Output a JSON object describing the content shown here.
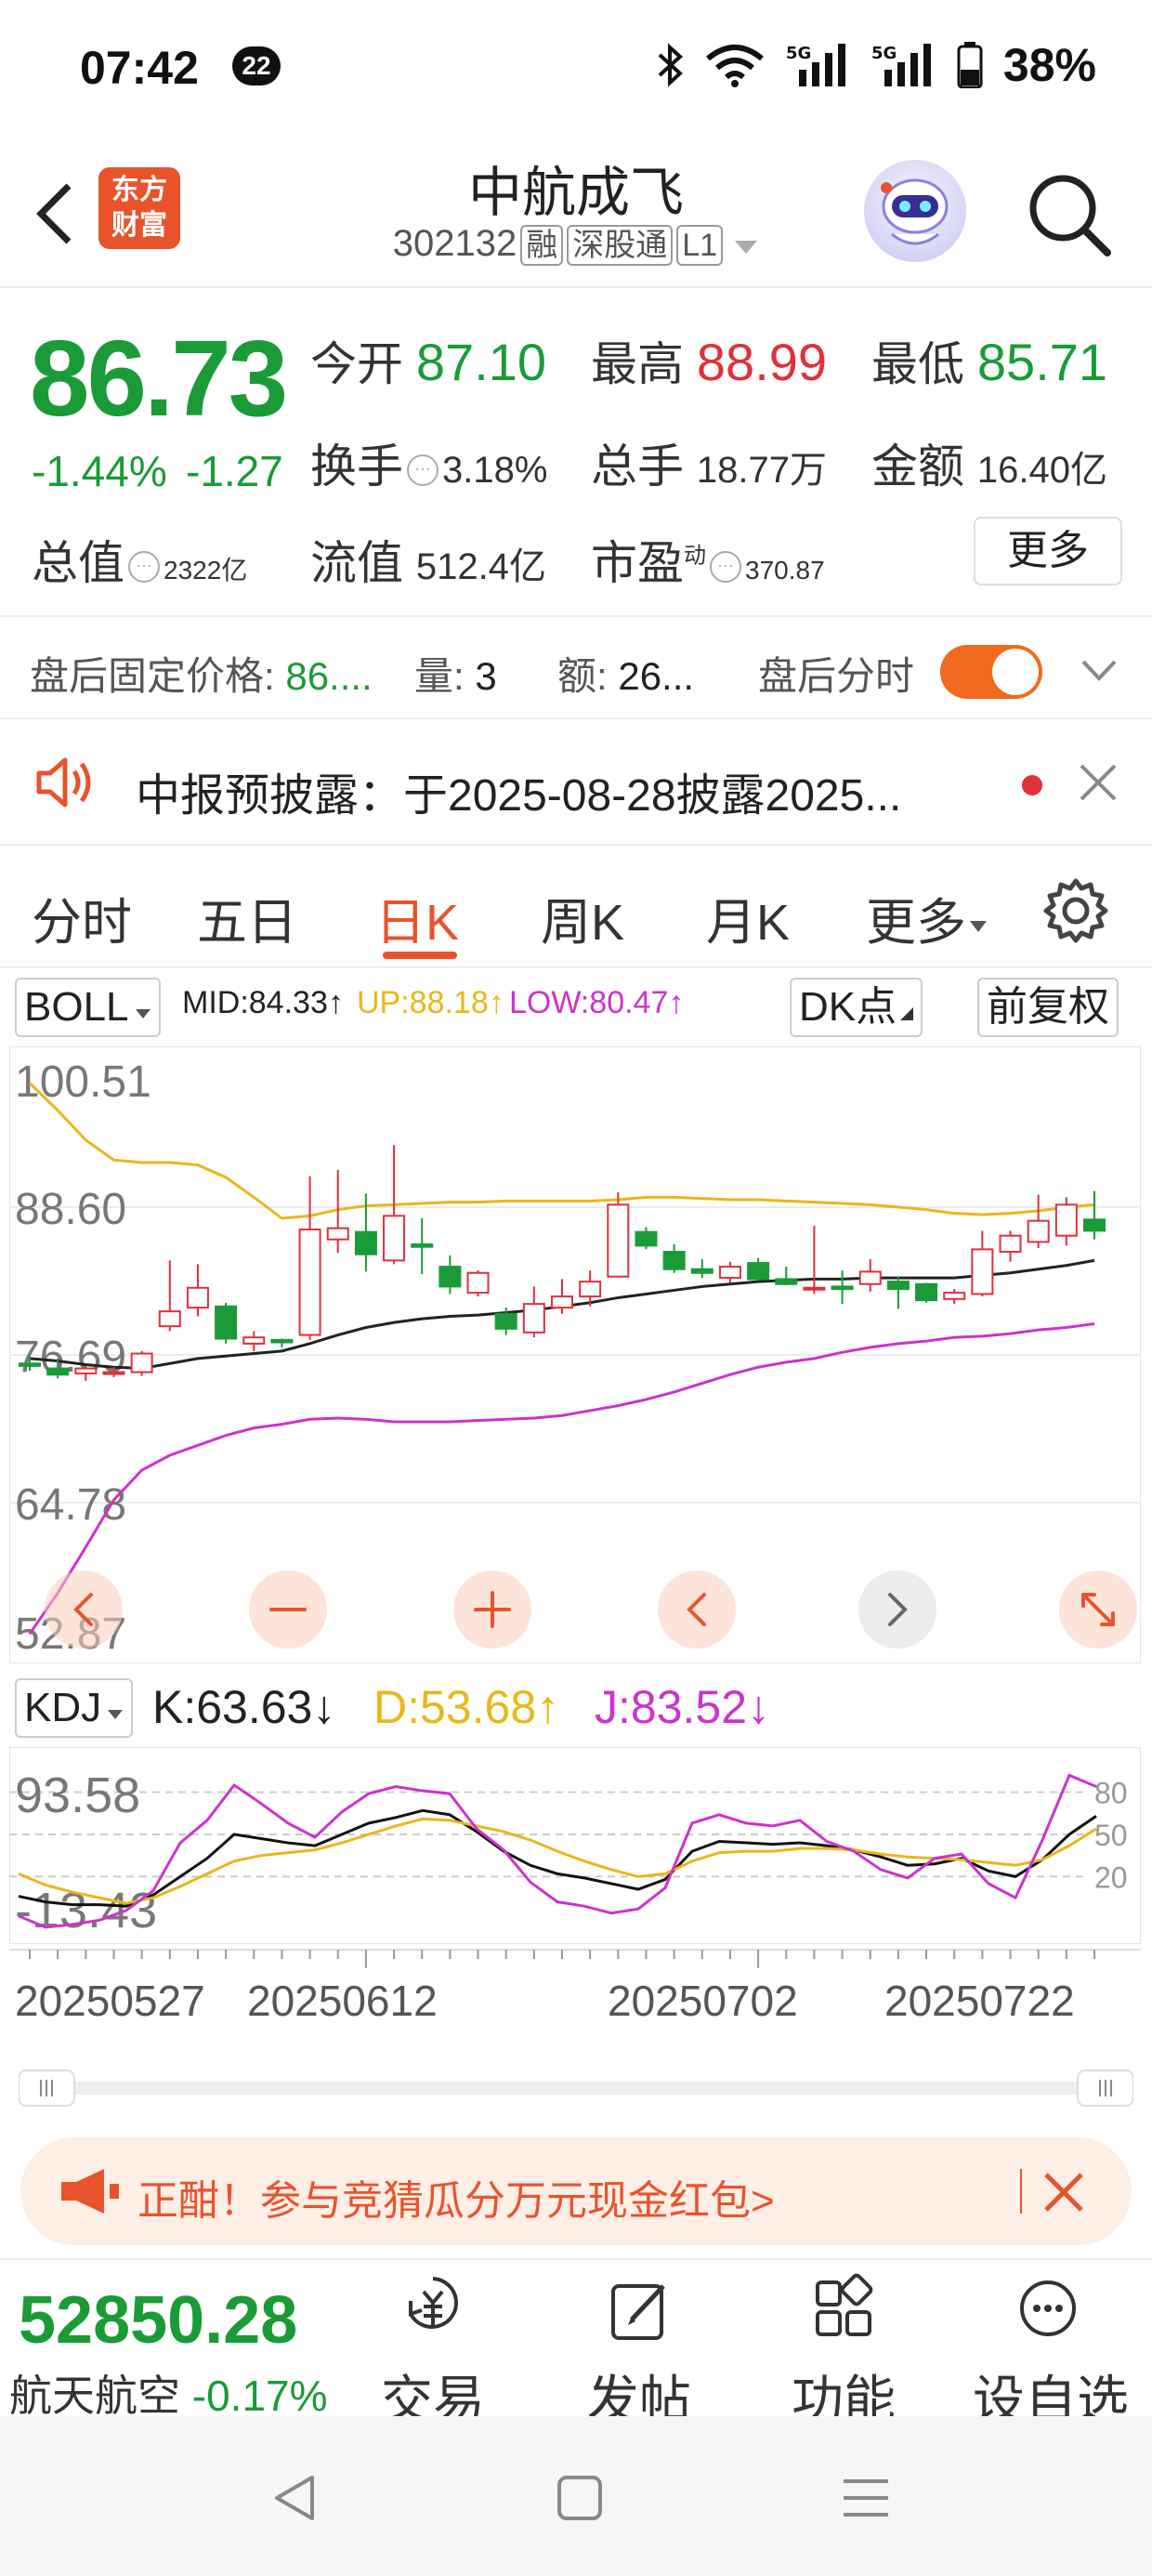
{
  "status_bar": {
    "time": "07:42",
    "notif_count": "22",
    "battery": "38%"
  },
  "header": {
    "logo_text_top": "东方",
    "logo_text_bottom": "财富",
    "stock_name": "中航成飞",
    "stock_code": "302132",
    "tag_margin": "融",
    "tag_connect": "深股通",
    "tag_level": "L1"
  },
  "quote": {
    "price": "86.73",
    "change_pct": "-1.44%",
    "change": "-1.27",
    "open_label": "今开",
    "open": "87.10",
    "high_label": "最高",
    "high": "88.99",
    "low_label": "最低",
    "low": "85.71",
    "turnover_label": "换手",
    "turnover": "3.18%",
    "volume_label": "总手",
    "volume": "18.77万",
    "amount_label": "金额",
    "amount": "16.40亿",
    "mktcap_label": "总值",
    "mktcap": "2322亿",
    "float_label": "流值",
    "float_cap": "512.4亿",
    "pe_label": "市盈",
    "pe_sup": "动",
    "pe": "370.87",
    "more_label": "更多"
  },
  "after_hours": {
    "price_label": "盘后固定价格:",
    "price": "86....",
    "vol_label": "量:",
    "vol": "3",
    "amt_label": "额:",
    "amt": "26...",
    "time_label": "盘后分时"
  },
  "notice": {
    "text": "中报预披露：于2025-08-28披露2025..."
  },
  "tabs": [
    {
      "label": "分时"
    },
    {
      "label": "五日"
    },
    {
      "label": "日K"
    },
    {
      "label": "周K"
    },
    {
      "label": "月K"
    },
    {
      "label": "更多"
    }
  ],
  "indicator": {
    "name": "BOLL",
    "mid": "MID:84.33↑",
    "up": "UP:88.18↑",
    "low": "LOW:80.47↑",
    "dk": "DK点",
    "adjust": "前复权"
  },
  "kdj": {
    "name": "KDJ",
    "k": "K:63.63↓",
    "d": "D:53.68↑",
    "j": "J:83.52↓"
  },
  "colors": {
    "up": "#e0303a",
    "down": "#1a9b37",
    "accent": "#e8532c",
    "boll_up": "#e8b71a",
    "boll_low": "#cc33cc"
  },
  "chart_data": [
    {
      "type": "candlestick",
      "title": "",
      "y_tick_labels": [
        "100.51",
        "88.60",
        "76.69",
        "64.78",
        "52.87"
      ],
      "ylim": [
        52.87,
        100.51
      ],
      "x_tick_labels": [
        "20250527",
        "20250612",
        "20250702",
        "20250722"
      ],
      "candles": [
        {
          "o": 76.0,
          "h": 76.6,
          "l": 75.4,
          "c": 75.8
        },
        {
          "o": 75.6,
          "h": 76.4,
          "l": 74.8,
          "c": 75.1
        },
        {
          "o": 75.2,
          "h": 75.8,
          "l": 74.6,
          "c": 75.6
        },
        {
          "o": 75.2,
          "h": 75.7,
          "l": 74.9,
          "c": 75.3
        },
        {
          "o": 75.3,
          "h": 77.0,
          "l": 75.0,
          "c": 76.8
        },
        {
          "o": 79.0,
          "h": 84.3,
          "l": 78.6,
          "c": 80.2
        },
        {
          "o": 80.5,
          "h": 84.0,
          "l": 79.8,
          "c": 82.1
        },
        {
          "o": 80.6,
          "h": 80.9,
          "l": 77.6,
          "c": 78.0
        },
        {
          "o": 77.6,
          "h": 78.6,
          "l": 77.0,
          "c": 78.1
        },
        {
          "o": 77.9,
          "h": 78.0,
          "l": 77.3,
          "c": 77.7
        },
        {
          "o": 78.3,
          "h": 91.1,
          "l": 77.9,
          "c": 86.8
        },
        {
          "o": 86.0,
          "h": 91.6,
          "l": 84.9,
          "c": 86.9
        },
        {
          "o": 86.6,
          "h": 89.7,
          "l": 83.4,
          "c": 84.8
        },
        {
          "o": 84.3,
          "h": 93.6,
          "l": 84.0,
          "c": 87.9
        },
        {
          "o": 85.6,
          "h": 87.7,
          "l": 83.2,
          "c": 85.4
        },
        {
          "o": 83.8,
          "h": 84.7,
          "l": 81.6,
          "c": 82.2
        },
        {
          "o": 81.7,
          "h": 83.5,
          "l": 81.4,
          "c": 83.3
        },
        {
          "o": 80.0,
          "h": 80.5,
          "l": 78.3,
          "c": 78.8
        },
        {
          "o": 78.5,
          "h": 82.2,
          "l": 78.1,
          "c": 80.8
        },
        {
          "o": 80.5,
          "h": 82.8,
          "l": 80.0,
          "c": 81.4
        },
        {
          "o": 81.4,
          "h": 83.5,
          "l": 80.6,
          "c": 82.6
        },
        {
          "o": 83.0,
          "h": 89.8,
          "l": 83.0,
          "c": 88.8
        },
        {
          "o": 86.6,
          "h": 87.0,
          "l": 85.2,
          "c": 85.5
        },
        {
          "o": 85.0,
          "h": 85.6,
          "l": 83.3,
          "c": 83.6
        },
        {
          "o": 83.6,
          "h": 84.4,
          "l": 82.9,
          "c": 83.3
        },
        {
          "o": 82.9,
          "h": 84.2,
          "l": 82.5,
          "c": 83.8
        },
        {
          "o": 84.1,
          "h": 84.5,
          "l": 82.7,
          "c": 82.8
        },
        {
          "o": 82.8,
          "h": 83.8,
          "l": 82.3,
          "c": 82.4
        },
        {
          "o": 82.0,
          "h": 87.1,
          "l": 81.6,
          "c": 82.1
        },
        {
          "o": 82.2,
          "h": 83.5,
          "l": 80.8,
          "c": 82.0
        },
        {
          "o": 82.4,
          "h": 84.4,
          "l": 81.8,
          "c": 83.4
        },
        {
          "o": 82.6,
          "h": 83.0,
          "l": 80.4,
          "c": 82.0
        },
        {
          "o": 82.4,
          "h": 82.5,
          "l": 80.9,
          "c": 81.1
        },
        {
          "o": 81.2,
          "h": 82.0,
          "l": 80.8,
          "c": 81.7
        },
        {
          "o": 81.6,
          "h": 86.7,
          "l": 81.4,
          "c": 85.2
        },
        {
          "o": 85.0,
          "h": 86.7,
          "l": 84.2,
          "c": 86.3
        },
        {
          "o": 85.8,
          "h": 89.6,
          "l": 85.3,
          "c": 87.5
        },
        {
          "o": 86.3,
          "h": 89.4,
          "l": 85.5,
          "c": 88.8
        },
        {
          "o": 87.6,
          "h": 89.9,
          "l": 86.0,
          "c": 86.7
        }
      ],
      "series": [
        {
          "name": "UP",
          "values": [
            98.6,
            96.4,
            94.0,
            92.4,
            92.2,
            92.2,
            92.0,
            91.0,
            89.4,
            87.7,
            87.9,
            88.4,
            88.7,
            88.8,
            88.9,
            89.0,
            89.0,
            89.1,
            89.1,
            89.1,
            89.1,
            89.2,
            89.4,
            89.4,
            89.3,
            89.2,
            89.2,
            89.1,
            89.0,
            88.9,
            88.8,
            88.6,
            88.4,
            88.1,
            88.0,
            88.1,
            88.3,
            88.6,
            88.8
          ]
        },
        {
          "name": "MID",
          "values": [
            76.4,
            76.2,
            75.9,
            75.7,
            75.6,
            76.0,
            76.4,
            76.6,
            76.8,
            77.0,
            77.6,
            78.3,
            78.9,
            79.3,
            79.6,
            79.8,
            79.9,
            80.1,
            80.3,
            80.6,
            80.9,
            81.3,
            81.6,
            81.9,
            82.2,
            82.4,
            82.6,
            82.7,
            82.8,
            82.8,
            82.9,
            82.9,
            82.9,
            82.9,
            83.1,
            83.3,
            83.6,
            83.9,
            84.3
          ]
        },
        {
          "name": "LOW",
          "values": [
            54.2,
            57.5,
            61.2,
            65.0,
            67.4,
            68.6,
            69.4,
            70.2,
            70.8,
            71.1,
            71.5,
            71.6,
            71.5,
            71.3,
            71.3,
            71.3,
            71.4,
            71.5,
            71.6,
            71.8,
            72.2,
            72.6,
            73.1,
            73.7,
            74.4,
            75.1,
            75.7,
            76.1,
            76.4,
            76.9,
            77.3,
            77.6,
            77.8,
            78.1,
            78.2,
            78.4,
            78.7,
            78.9,
            79.2
          ]
        }
      ]
    },
    {
      "type": "line",
      "title": "",
      "y_tick_labels": [
        "93.58",
        "-13.43"
      ],
      "right_tick_labels": [
        "80",
        "50",
        "20"
      ],
      "ylim": [
        -13.43,
        93.58
      ],
      "series": [
        {
          "name": "K",
          "values": [
            6,
            2,
            0,
            0,
            -1,
            7,
            20,
            33,
            50,
            47,
            44,
            42,
            50,
            58,
            62,
            67,
            64,
            52,
            38,
            28,
            22,
            19,
            15,
            11,
            18,
            38,
            45,
            44,
            43,
            44,
            42,
            39,
            34,
            28,
            29,
            33,
            24,
            20,
            32,
            50,
            63
          ]
        },
        {
          "name": "D",
          "values": [
            22,
            14,
            9,
            5,
            1,
            5,
            13,
            22,
            31,
            35,
            37,
            39,
            44,
            50,
            56,
            61,
            60,
            56,
            52,
            46,
            38,
            31,
            25,
            20,
            22,
            31,
            37,
            38,
            38,
            40,
            40,
            39,
            36,
            34,
            33,
            32,
            30,
            28,
            32,
            42,
            54
          ]
        },
        {
          "name": "J",
          "values": [
            -8,
            -16,
            -14,
            -11,
            -4,
            10,
            44,
            60,
            85,
            72,
            58,
            48,
            66,
            79,
            84,
            81,
            79,
            54,
            39,
            16,
            2,
            -1,
            -6,
            -3,
            12,
            58,
            64,
            58,
            56,
            60,
            45,
            38,
            25,
            19,
            33,
            36,
            15,
            5,
            46,
            92,
            84
          ]
        }
      ]
    }
  ],
  "kdj_note": "KDJ indicator panel",
  "promo": {
    "text": "正酣！参与竞猜瓜分万元现金红包>"
  },
  "bottom_bar": {
    "index_value": "52850.28",
    "index_name": "航天航空",
    "index_pct": "-0.17%",
    "trade_label": "交易",
    "post_label": "发帖",
    "func_label": "功能",
    "watch_label": "设自选"
  }
}
